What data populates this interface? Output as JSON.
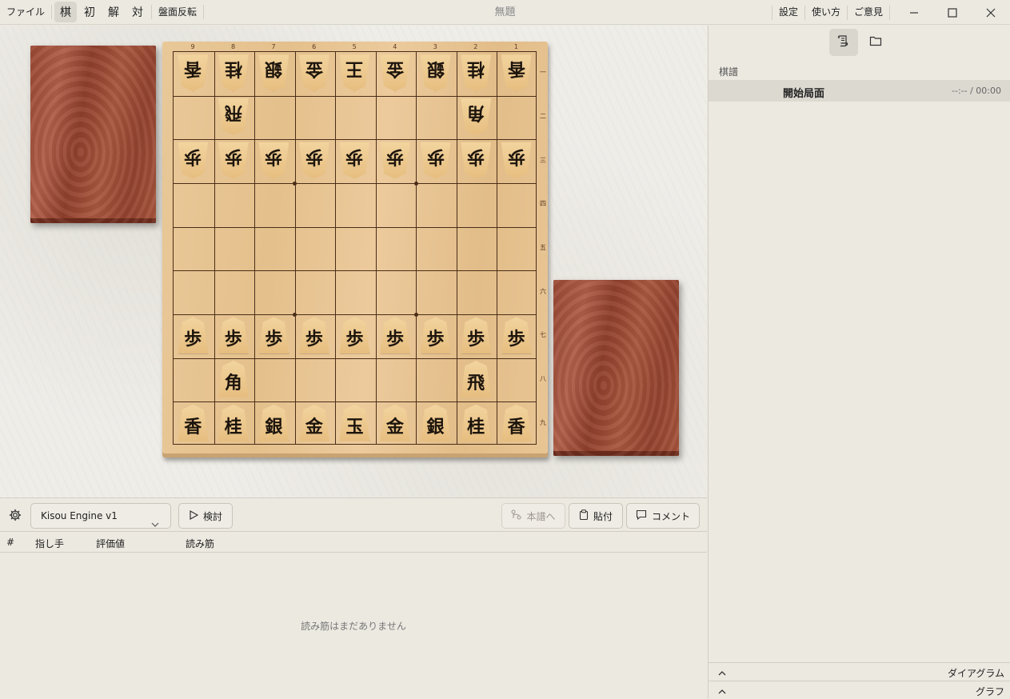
{
  "menu": {
    "file": "ファイル",
    "mode_board": "棋",
    "mode_init": "初",
    "mode_analyze": "解",
    "mode_play": "対",
    "flip": "盤面反転"
  },
  "window": {
    "title": "無題",
    "settings": "設定",
    "howto": "使い方",
    "feedback": "ご意見"
  },
  "board": {
    "files": [
      "9",
      "8",
      "7",
      "6",
      "5",
      "4",
      "3",
      "2",
      "1"
    ],
    "ranks": [
      "一",
      "二",
      "三",
      "四",
      "五",
      "六",
      "七",
      "八",
      "九"
    ],
    "pieces": [
      {
        "f": 0,
        "r": 0,
        "c": "香",
        "gote": true
      },
      {
        "f": 1,
        "r": 0,
        "c": "桂",
        "gote": true
      },
      {
        "f": 2,
        "r": 0,
        "c": "銀",
        "gote": true
      },
      {
        "f": 3,
        "r": 0,
        "c": "金",
        "gote": true
      },
      {
        "f": 4,
        "r": 0,
        "c": "王",
        "gote": true
      },
      {
        "f": 5,
        "r": 0,
        "c": "金",
        "gote": true
      },
      {
        "f": 6,
        "r": 0,
        "c": "銀",
        "gote": true
      },
      {
        "f": 7,
        "r": 0,
        "c": "桂",
        "gote": true
      },
      {
        "f": 8,
        "r": 0,
        "c": "香",
        "gote": true
      },
      {
        "f": 1,
        "r": 1,
        "c": "飛",
        "gote": true
      },
      {
        "f": 7,
        "r": 1,
        "c": "角",
        "gote": true
      },
      {
        "f": 0,
        "r": 2,
        "c": "歩",
        "gote": true
      },
      {
        "f": 1,
        "r": 2,
        "c": "歩",
        "gote": true
      },
      {
        "f": 2,
        "r": 2,
        "c": "歩",
        "gote": true
      },
      {
        "f": 3,
        "r": 2,
        "c": "歩",
        "gote": true
      },
      {
        "f": 4,
        "r": 2,
        "c": "歩",
        "gote": true
      },
      {
        "f": 5,
        "r": 2,
        "c": "歩",
        "gote": true
      },
      {
        "f": 6,
        "r": 2,
        "c": "歩",
        "gote": true
      },
      {
        "f": 7,
        "r": 2,
        "c": "歩",
        "gote": true
      },
      {
        "f": 8,
        "r": 2,
        "c": "歩",
        "gote": true
      },
      {
        "f": 0,
        "r": 6,
        "c": "歩",
        "gote": false
      },
      {
        "f": 1,
        "r": 6,
        "c": "歩",
        "gote": false
      },
      {
        "f": 2,
        "r": 6,
        "c": "歩",
        "gote": false
      },
      {
        "f": 3,
        "r": 6,
        "c": "歩",
        "gote": false
      },
      {
        "f": 4,
        "r": 6,
        "c": "歩",
        "gote": false
      },
      {
        "f": 5,
        "r": 6,
        "c": "歩",
        "gote": false
      },
      {
        "f": 6,
        "r": 6,
        "c": "歩",
        "gote": false
      },
      {
        "f": 7,
        "r": 6,
        "c": "歩",
        "gote": false
      },
      {
        "f": 8,
        "r": 6,
        "c": "歩",
        "gote": false
      },
      {
        "f": 1,
        "r": 7,
        "c": "角",
        "gote": false
      },
      {
        "f": 7,
        "r": 7,
        "c": "飛",
        "gote": false
      },
      {
        "f": 0,
        "r": 8,
        "c": "香",
        "gote": false
      },
      {
        "f": 1,
        "r": 8,
        "c": "桂",
        "gote": false
      },
      {
        "f": 2,
        "r": 8,
        "c": "銀",
        "gote": false
      },
      {
        "f": 3,
        "r": 8,
        "c": "金",
        "gote": false
      },
      {
        "f": 4,
        "r": 8,
        "c": "玉",
        "gote": false
      },
      {
        "f": 5,
        "r": 8,
        "c": "金",
        "gote": false
      },
      {
        "f": 6,
        "r": 8,
        "c": "銀",
        "gote": false
      },
      {
        "f": 7,
        "r": 8,
        "c": "桂",
        "gote": false
      },
      {
        "f": 8,
        "r": 8,
        "c": "香",
        "gote": false
      }
    ]
  },
  "analysis": {
    "engine": "Kisou Engine v1",
    "analyze_label": "検討",
    "to_main_label": "本譜へ",
    "paste_label": "貼付",
    "comment_label": "コメント",
    "columns": [
      "#",
      "指し手",
      "評価値",
      "読み筋"
    ],
    "empty": "読み筋はまだありません"
  },
  "side": {
    "kifu_label": "棋譜",
    "moves": [
      {
        "move": "開始局面",
        "time": "--:-- / 00:00"
      }
    ],
    "diagram_label": "ダイアグラム",
    "graph_label": "グラフ"
  }
}
